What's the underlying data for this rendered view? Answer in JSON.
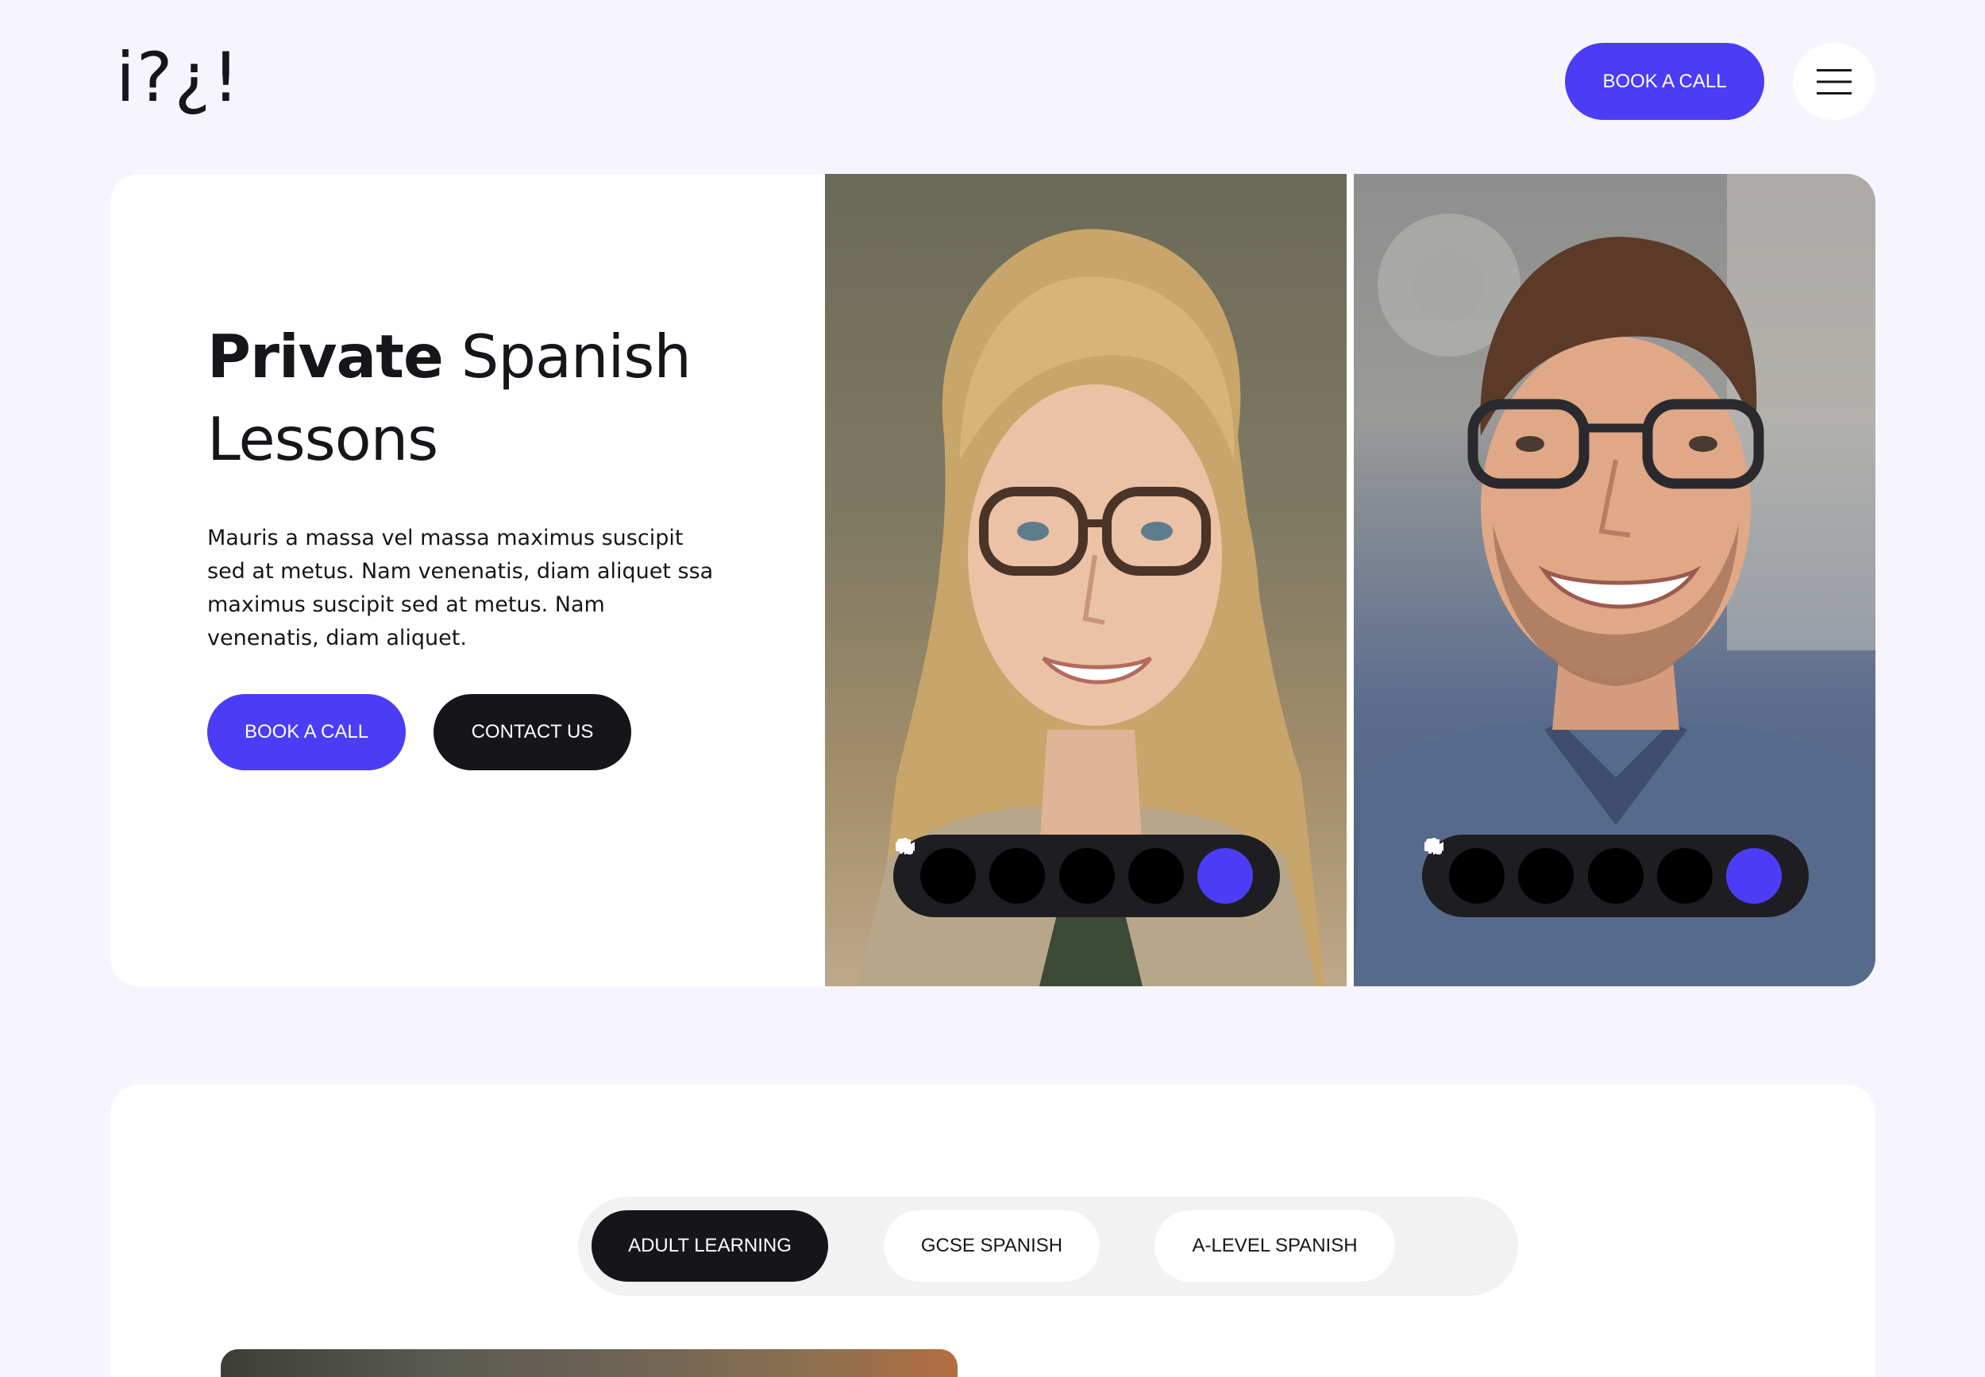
{
  "header": {
    "logo_text": "i?¿!",
    "book_label": "BOOK A CALL",
    "menu_icon": "hamburger-icon"
  },
  "hero": {
    "title_bold": "Private",
    "title_rest": " Spanish Lessons",
    "body": "Mauris a massa vel massa maximus suscipit sed at metus. Nam venenatis, diam aliquet ssa maximus suscipit sed at metus. Nam venenatis, diam aliquet.",
    "book_label": "BOOK A CALL",
    "contact_label": "CONTACT US"
  },
  "call_controls": {
    "icons": [
      "more-icon",
      "video-camera-icon",
      "pause-icon",
      "microphone-icon",
      "phone-icon"
    ]
  },
  "tabs": {
    "items": [
      {
        "label": "ADULT LEARNING",
        "active": true
      },
      {
        "label": "GCSE SPANISH",
        "active": false
      },
      {
        "label": "A-LEVEL SPANISH",
        "active": false
      }
    ]
  },
  "colors": {
    "accent": "#4B3DF5",
    "dark": "#16161A",
    "background": "#F6F5FD"
  }
}
